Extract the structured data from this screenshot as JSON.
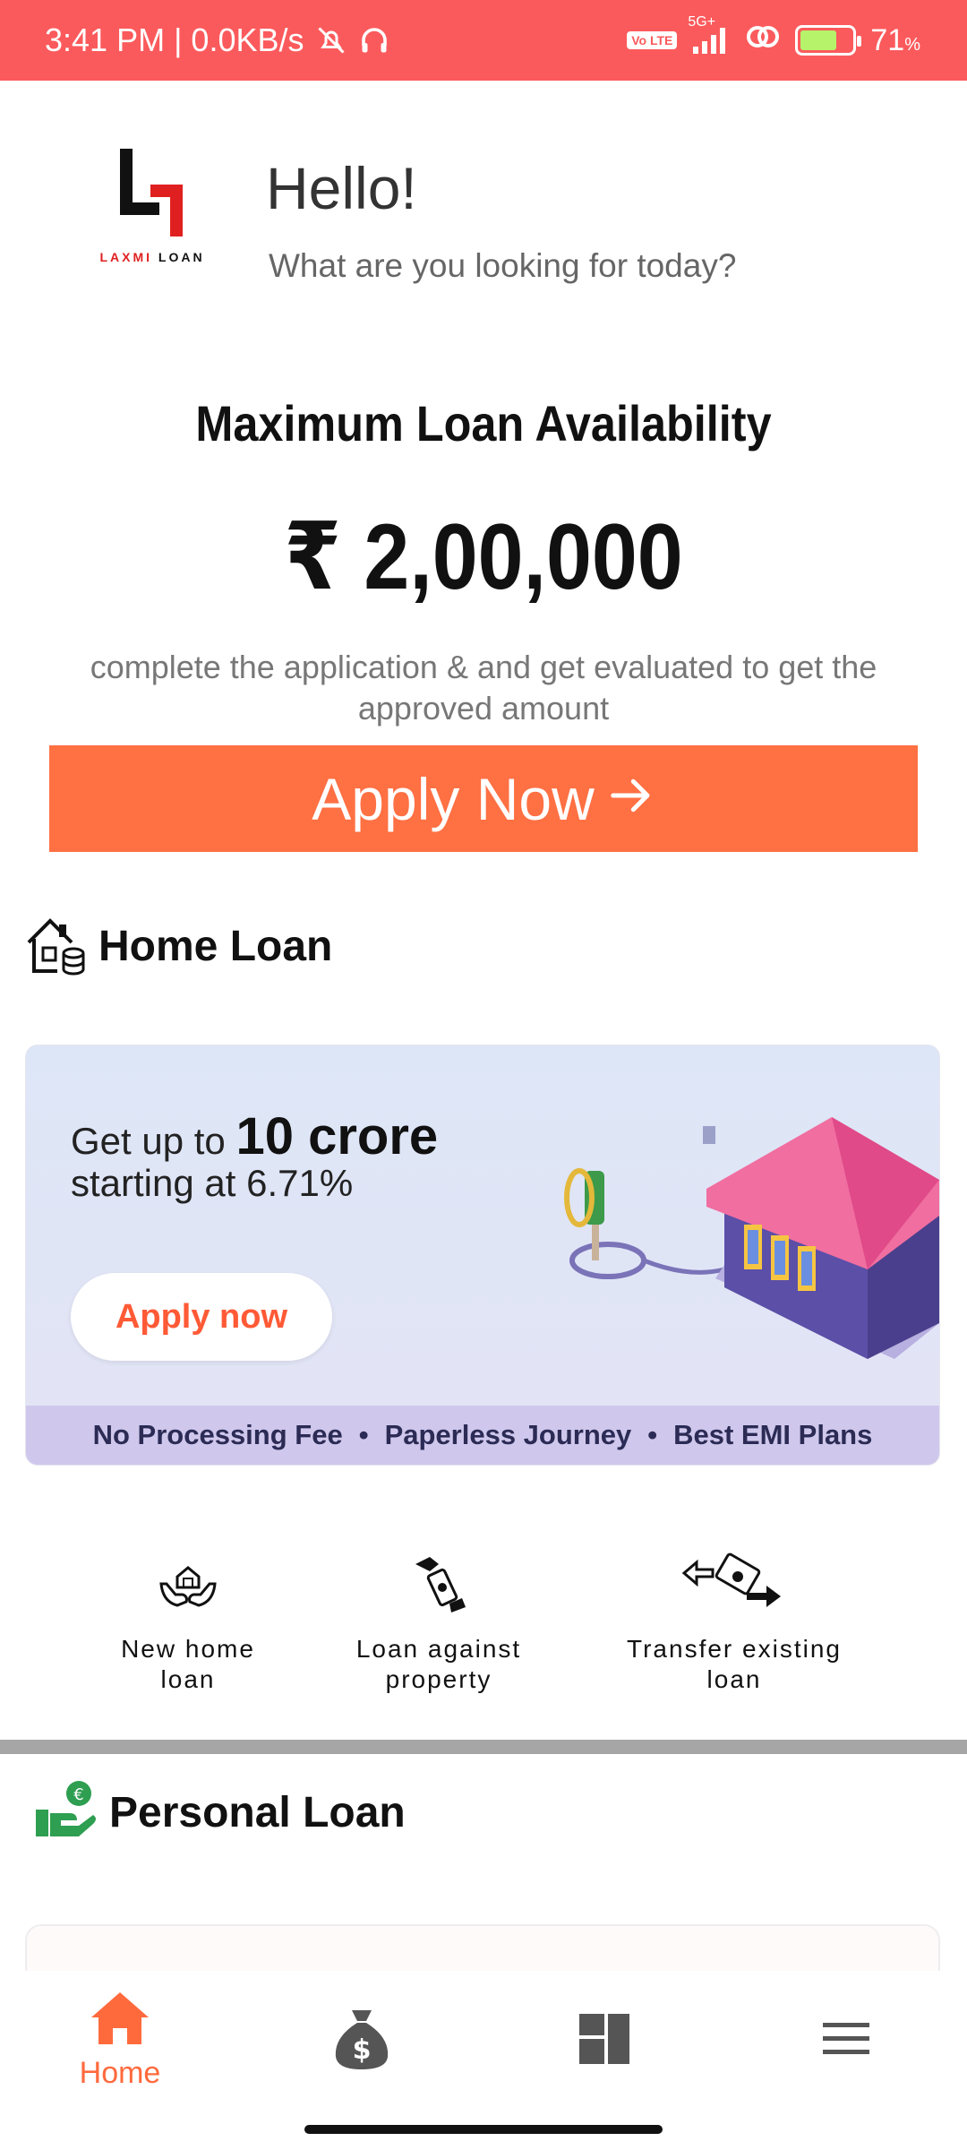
{
  "status_bar": {
    "time_speed": "3:41 PM | 0.0KB/s",
    "network": "5G+",
    "volte": "Vo LTE",
    "battery_pct": "71",
    "battery_unit": "%",
    "battery_level": 0.71
  },
  "header": {
    "logo_text_1": "LAXMI",
    "logo_text_2": "LOAN",
    "greeting": "Hello!",
    "subtitle": "What are you looking for today?"
  },
  "availability": {
    "title": "Maximum Loan Availability",
    "amount": "₹ 2,00,000",
    "note": "complete the application & and get evaluated to get the approved amount",
    "apply_label": "Apply Now"
  },
  "home_loan": {
    "title": "Home Loan",
    "banner": {
      "prefix": "Get up to ",
      "highlight": "10 crore",
      "line2": "starting at 6.71%",
      "button": "Apply now",
      "features": [
        "No Processing Fee",
        "Paperless Journey",
        "Best EMI Plans"
      ]
    },
    "options": [
      {
        "label_1": "New home",
        "label_2": "loan"
      },
      {
        "label_1": "Loan against",
        "label_2": "property"
      },
      {
        "label_1": "Transfer existing",
        "label_2": "loan"
      }
    ]
  },
  "personal_loan": {
    "title": "Personal Loan"
  },
  "bottom_nav": {
    "home_label": "Home",
    "active_color": "#ff6a3d",
    "inactive_color": "#555555"
  },
  "colors": {
    "status_bar": "#fb5a5c",
    "apply_button": "#ff7043",
    "banner_accent": "#ff5a36"
  }
}
